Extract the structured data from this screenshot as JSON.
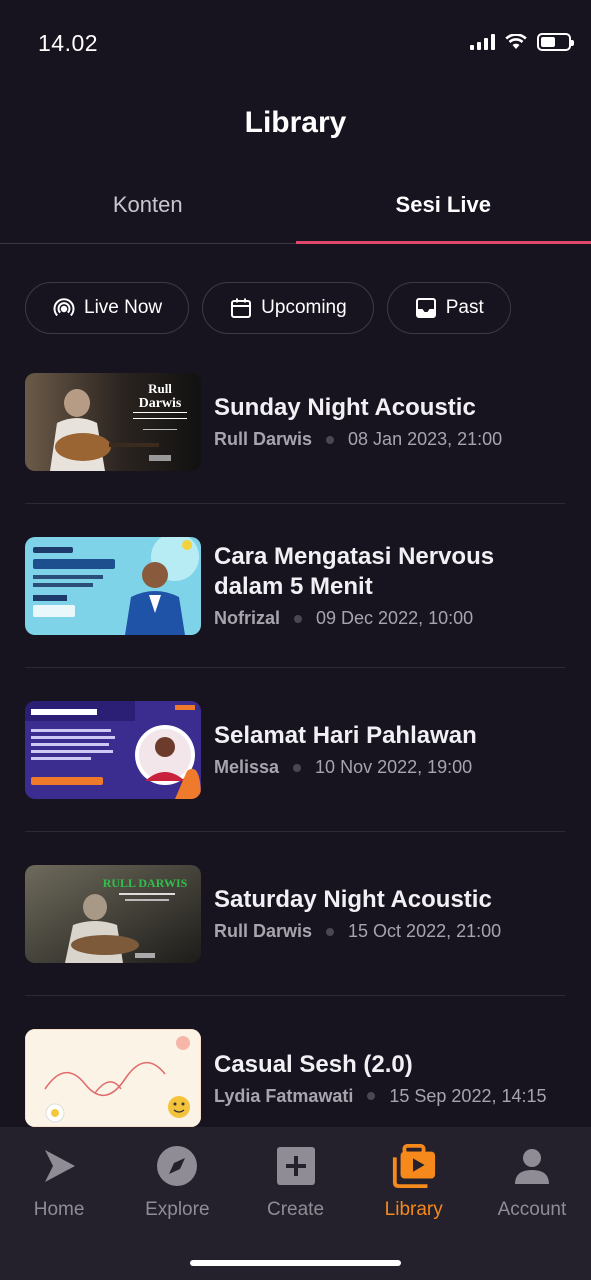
{
  "status": {
    "time": "14.02"
  },
  "title": "Library",
  "tabs": [
    {
      "label": "Konten"
    },
    {
      "label": "Sesi Live"
    }
  ],
  "filters": [
    {
      "label": "Live Now",
      "icon": "broadcast-icon"
    },
    {
      "label": "Upcoming",
      "icon": "calendar-icon"
    },
    {
      "label": "Past",
      "icon": "inbox-icon"
    }
  ],
  "items": [
    {
      "title": "Sunday Night Acoustic",
      "author": "Rull Darwis",
      "date": "08 Jan 2023, 21:00"
    },
    {
      "title": "Cara Mengatasi Nervous dalam 5 Menit",
      "author": "Nofrizal",
      "date": "09 Dec 2022, 10:00"
    },
    {
      "title": "Selamat Hari Pahlawan",
      "author": "Melissa",
      "date": "10 Nov 2022, 19:00"
    },
    {
      "title": "Saturday Night Acoustic",
      "author": "Rull Darwis",
      "date": "15 Oct 2022, 21:00"
    },
    {
      "title": "Casual Sesh (2.0)",
      "author": "Lydia Fatmawati",
      "date": "15 Sep 2022, 14:15"
    }
  ],
  "nav": [
    {
      "label": "Home",
      "icon": "home-play-icon"
    },
    {
      "label": "Explore",
      "icon": "compass-icon"
    },
    {
      "label": "Create",
      "icon": "plus-square-icon"
    },
    {
      "label": "Library",
      "icon": "library-icon"
    },
    {
      "label": "Account",
      "icon": "person-icon"
    }
  ],
  "colors": {
    "accent": "#f5891c",
    "tab_underline": "#e0476a",
    "background": "#17141f",
    "nav_background": "#24212c"
  }
}
